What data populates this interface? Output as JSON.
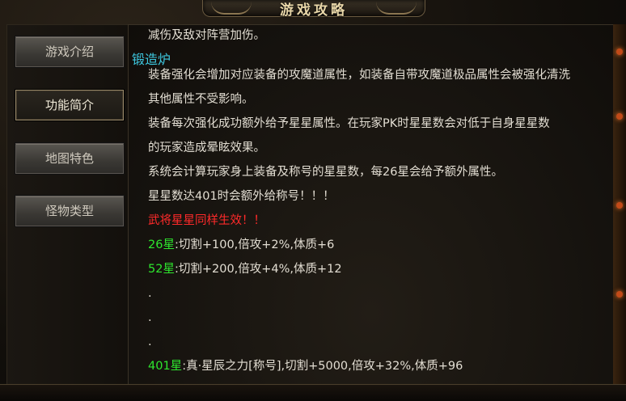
{
  "window": {
    "title": "游戏攻略"
  },
  "nav": [
    {
      "label": "游戏介绍",
      "active": false
    },
    {
      "label": "功能简介",
      "active": true
    },
    {
      "label": "地图特色",
      "active": false
    },
    {
      "label": "怪物类型",
      "active": false
    }
  ],
  "content": {
    "intro_line": "减伤及敌对阵营加伤。",
    "section_title": "锻造炉",
    "paragraphs": [
      "装备强化会增加对应装备的攻魔道属性，如装备自带攻魔道极品属性会被强化清洗",
      "其他属性不受影响。",
      "装备每次强化成功额外给予星星属性。在玩家PK时星星数会对低于自身星星数",
      "的玩家造成晕眩效果。",
      "系统会计算玩家身上装备及称号的星星数，每26星会给予额外属性。",
      "星星数达401时会额外给称号！！！"
    ],
    "warning": "武将星星同样生效！！",
    "rewards": [
      {
        "stars": "26星",
        "text": ":切割+100,倍攻+2%,体质+6"
      },
      {
        "stars": "52星",
        "text": ":切割+200,倍攻+4%,体质+12"
      }
    ],
    "ellipsis": [
      ".",
      ".",
      "."
    ],
    "final_reward": {
      "stars": "401星",
      "text": ":真·星辰之力[称号],切割+5000,倍攻+32%,体质+96"
    }
  },
  "colors": {
    "section_title": "#3ec8e0",
    "warning": "#ff2a2a",
    "stars": "#2ee62e",
    "body_text": "#e2ddd2"
  }
}
